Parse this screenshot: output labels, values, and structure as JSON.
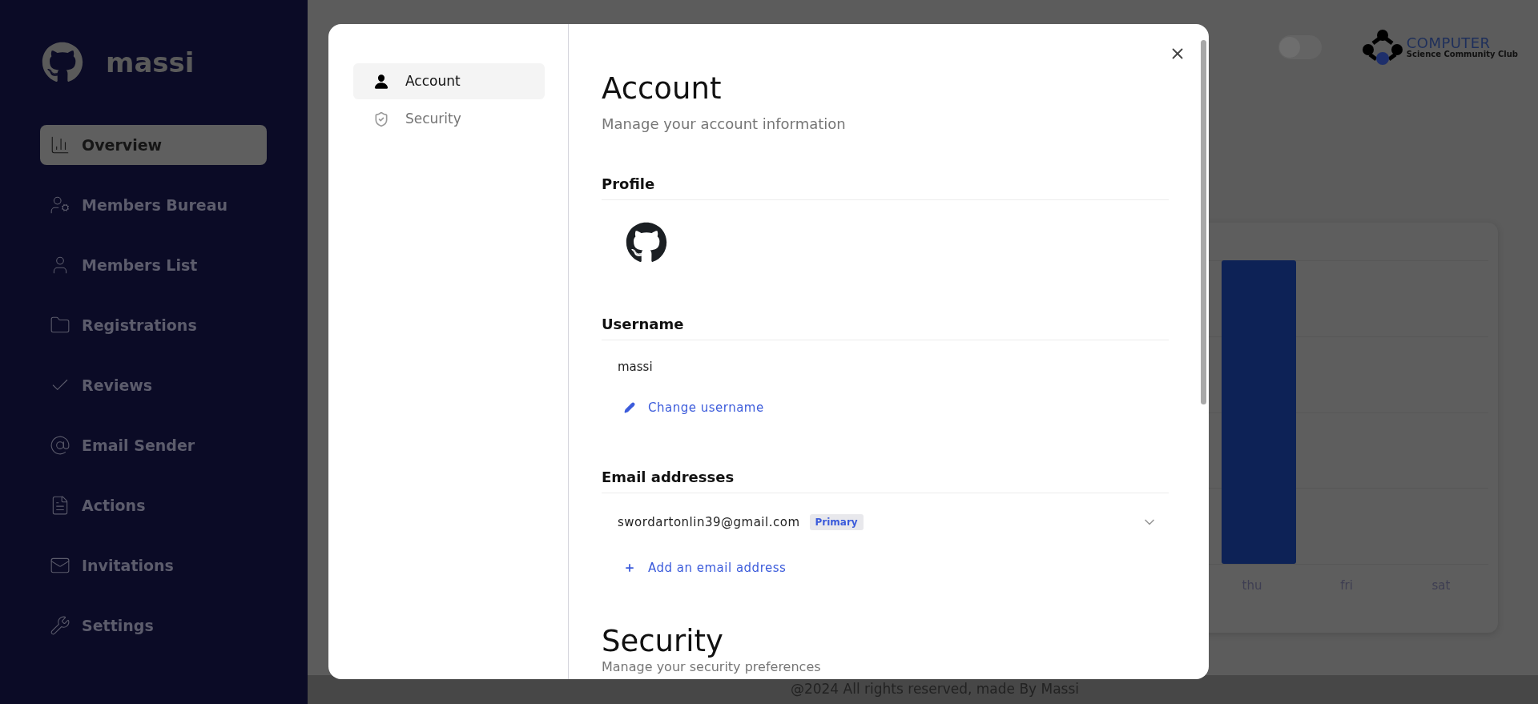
{
  "sidebar": {
    "brand": "massi",
    "items": [
      {
        "label": "Overview",
        "kind": "chart",
        "selected": true
      },
      {
        "label": "Members Bureau",
        "kind": "bureau",
        "selected": false
      },
      {
        "label": "Members List",
        "kind": "user",
        "selected": false
      },
      {
        "label": "Registrations",
        "kind": "folder",
        "selected": false
      },
      {
        "label": "Reviews",
        "kind": "check",
        "selected": false
      },
      {
        "label": "Email Sender",
        "kind": "at",
        "selected": false
      },
      {
        "label": "Actions",
        "kind": "file",
        "selected": false
      },
      {
        "label": "Invitations",
        "kind": "mail",
        "selected": false
      },
      {
        "label": "Settings",
        "kind": "wrench",
        "selected": false
      }
    ]
  },
  "header": {
    "theme_toggle": {
      "on": false
    },
    "logo": {
      "title": "COMPUTER",
      "subtitle": "Science Community Club"
    }
  },
  "chart": {
    "labels": [
      "thu",
      "fri",
      "sat"
    ]
  },
  "modal": {
    "nav": [
      {
        "label": "Account",
        "kind": "user",
        "selected": true
      },
      {
        "label": "Security",
        "kind": "shield",
        "selected": false
      }
    ],
    "title": "Account",
    "subtitle": "Manage your account information",
    "profile": {
      "heading": "Profile"
    },
    "username": {
      "heading": "Username",
      "value": "massi",
      "action": "Change username"
    },
    "emails": {
      "heading": "Email addresses",
      "items": [
        {
          "address": "swordartonlin39@gmail.com",
          "badge": "Primary"
        }
      ],
      "action": "Add an email address"
    },
    "security": {
      "title": "Security",
      "subtitle": "Manage your security preferences"
    }
  },
  "footer": "@2024 All rights reserved, made By Massi"
}
